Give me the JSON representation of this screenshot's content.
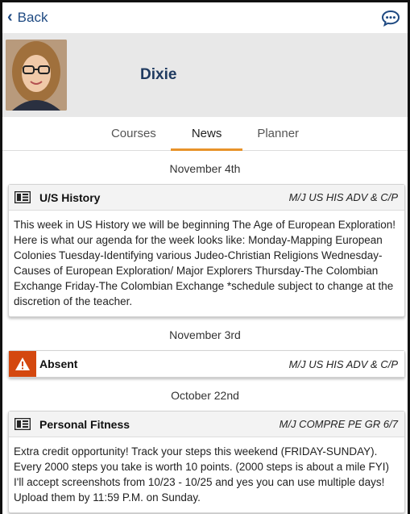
{
  "header": {
    "back_label": "Back",
    "chat_icon": "chat-bubble-icon"
  },
  "profile": {
    "name": "Dixie"
  },
  "tabs": [
    {
      "label": "Courses",
      "active": false
    },
    {
      "label": "News",
      "active": true
    },
    {
      "label": "Planner",
      "active": false
    }
  ],
  "feed": [
    {
      "date": "November 4th",
      "type": "news",
      "icon": "newspaper-icon",
      "title": "U/S History",
      "course": "M/J US HIS ADV & C/P",
      "body": "This week in US History we will be beginning The Age of European Exploration! Here is what our agenda for the week looks like: Monday-Mapping European Colonies Tuesday-Identifying various Judeo-Christian Religions Wednesday-Causes of European Exploration/ Major Explorers Thursday-The Colombian Exchange Friday-The Colombian Exchange *schedule subject to change at the discretion of the teacher."
    },
    {
      "date": "November 3rd",
      "type": "absent",
      "icon": "warning-icon",
      "title": "Absent",
      "course": "M/J US HIS ADV & C/P",
      "body": ""
    },
    {
      "date": "October 22nd",
      "type": "news",
      "icon": "newspaper-icon",
      "title": "Personal Fitness",
      "course": "M/J COMPRE PE GR 6/7",
      "body": "Extra credit opportunity! Track your steps this weekend (FRIDAY-SUNDAY). Every 2000 steps you take is worth 10 points. (2000 steps is about a mile FYI) I'll accept screenshots from 10/23 - 10/25 and yes you can use multiple days! Upload them by 11:59 P.M. on Sunday."
    }
  ],
  "colors": {
    "accent": "#e8932a",
    "brand": "#1f4a82",
    "warning": "#d4480f"
  }
}
